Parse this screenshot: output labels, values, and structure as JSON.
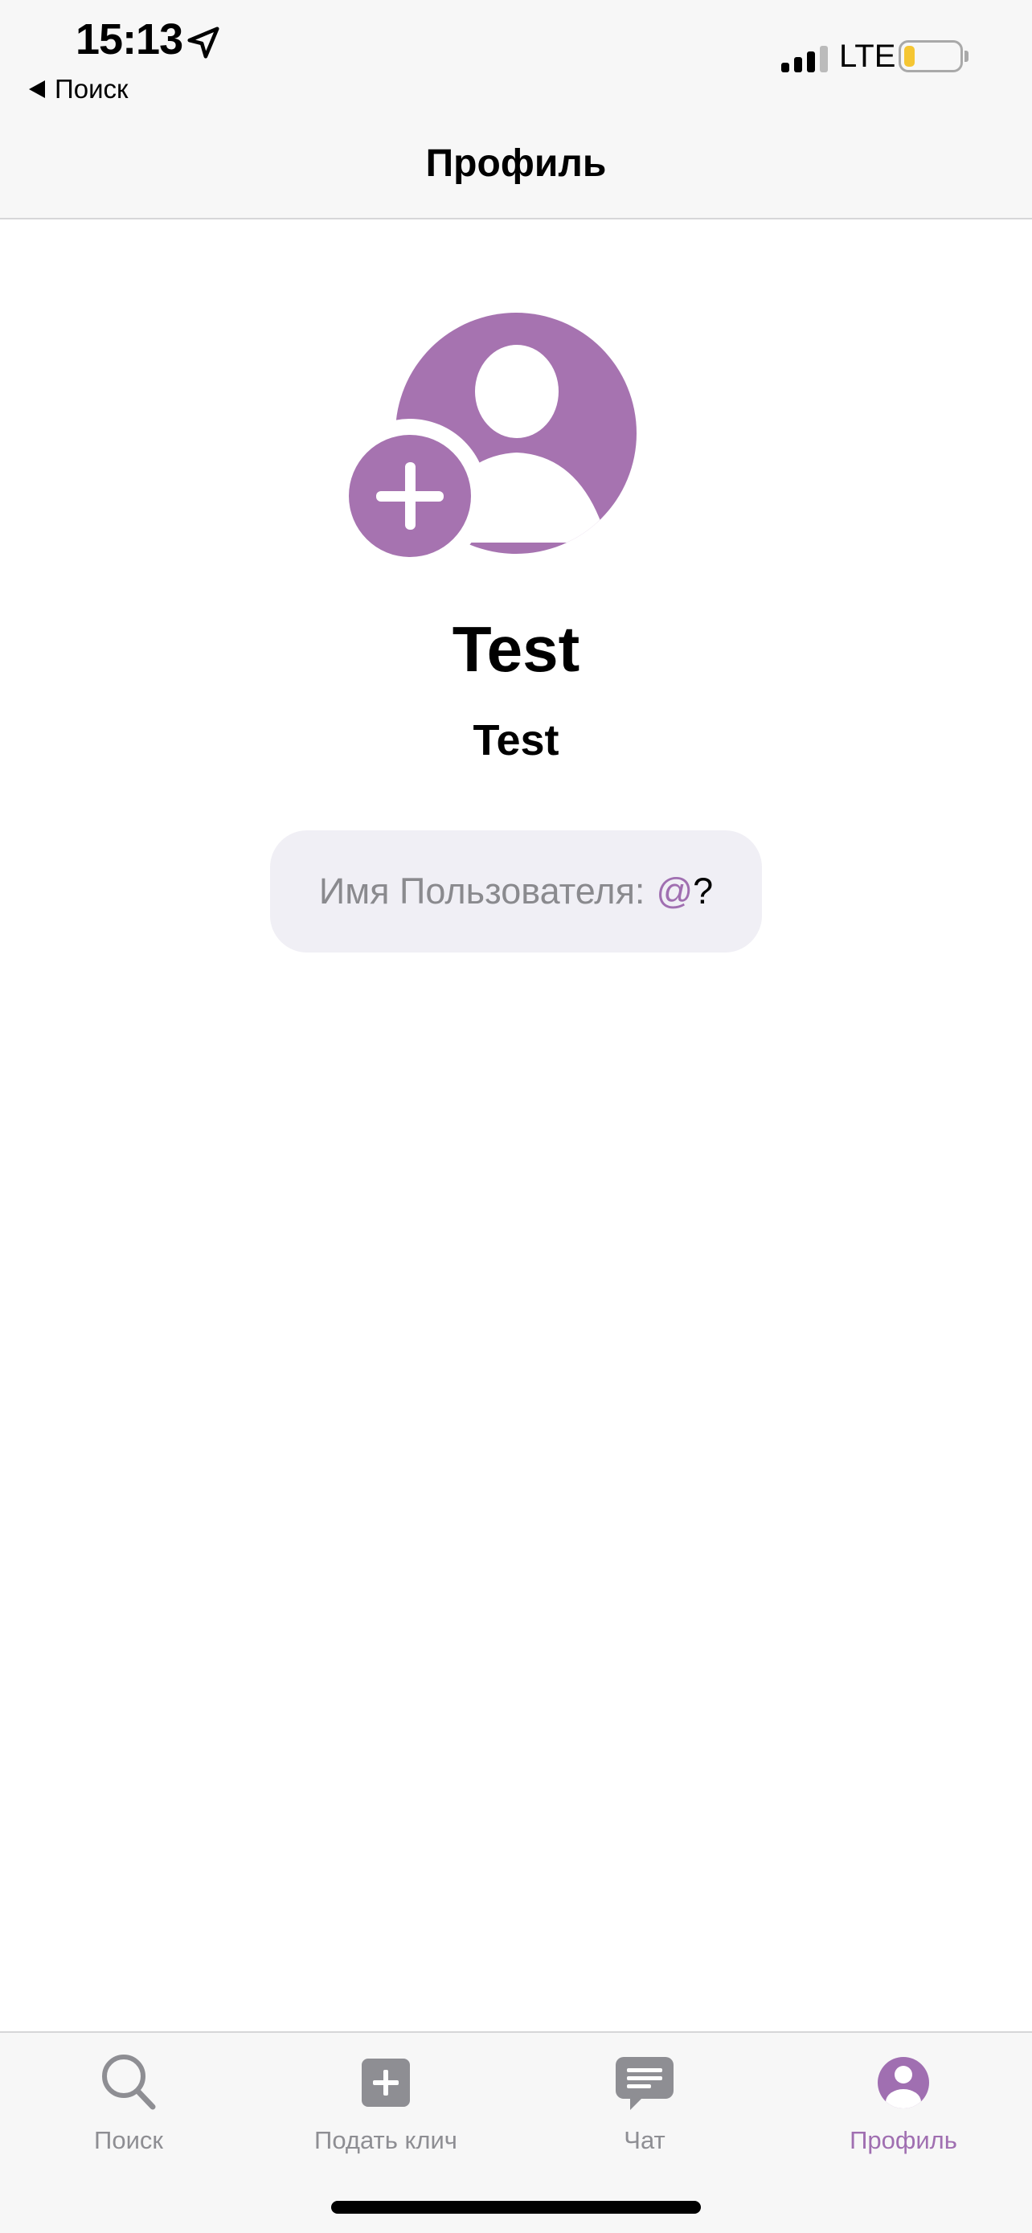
{
  "status_bar": {
    "time": "15:13",
    "network": "LTE",
    "battery_level": 0.2,
    "signal_bars_active": 3,
    "signal_bars_total": 4
  },
  "nav": {
    "back_label": "Поиск",
    "title": "Профиль"
  },
  "profile": {
    "display_name": "Test",
    "sub_name": "Test",
    "username_label": "Имя Пользователя:",
    "username_at": "@",
    "username_value": "?"
  },
  "tabs": [
    {
      "label": "Поиск",
      "icon": "search-icon",
      "active": false
    },
    {
      "label": "Подать клич",
      "icon": "plus-square-icon",
      "active": false
    },
    {
      "label": "Чат",
      "icon": "chat-bubble-icon",
      "active": false
    },
    {
      "label": "Профиль",
      "icon": "person-circle-icon",
      "active": true
    }
  ],
  "colors": {
    "accent": "#a06fb1",
    "avatar": "#a673b0",
    "tab_inactive": "#8e8e93",
    "pill_background": "#f0eff5",
    "battery_fill": "#f5c633"
  }
}
